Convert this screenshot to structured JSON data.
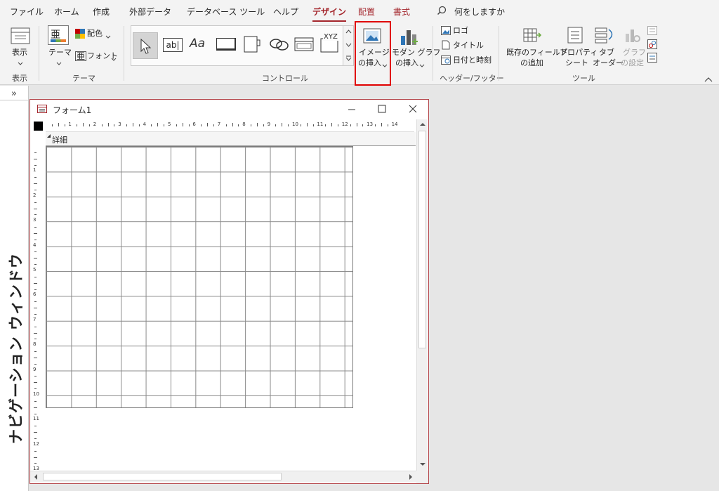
{
  "menu": {
    "file": "ファイル",
    "home": "ホーム",
    "create": "作成",
    "external_data": "外部データ",
    "database_tools": "データベース ツール",
    "help": "ヘルプ",
    "design": "デザイン",
    "arrange": "配置",
    "format": "書式",
    "tell_me": "何をしますか"
  },
  "ribbon": {
    "view": {
      "label": "表示",
      "group": "表示"
    },
    "theme": {
      "theme_label": "テーマ",
      "colors_label": "配色",
      "fonts_label": "フォント",
      "group": "テーマ",
      "theme_glyph": "亜",
      "font_glyph": "亜"
    },
    "controls": {
      "group": "コントロール",
      "textbox_glyph": "ab|",
      "label_glyph": "Aa",
      "xyz_glyph": "XYZ"
    },
    "insert_image": {
      "line1": "イメージ",
      "line2": "の挿入"
    },
    "modern_chart": {
      "line1": "モダン グラフ",
      "line2": "の挿入"
    },
    "header_footer": {
      "logo": "ロゴ",
      "title": "タイトル",
      "datetime": "日付と時刻",
      "group": "ヘッダー/フッター"
    },
    "tools": {
      "existing_fields": {
        "line1": "既存のフィールド",
        "line2": "の追加"
      },
      "property_sheet": {
        "line1": "プロパティ",
        "line2": "シート"
      },
      "tab_order": {
        "line1": "タブ",
        "line2": "オーダー"
      },
      "chart_settings": {
        "line1": "グラフ",
        "line2": "の設定"
      },
      "group": "ツール"
    }
  },
  "nav_pane": {
    "title": "ナビゲーション ウィンドウ",
    "expand": "»"
  },
  "form_window": {
    "title": "フォーム1",
    "section_label": "詳細",
    "ruler_h": [
      "1",
      "2",
      "3",
      "4",
      "5",
      "6",
      "7",
      "8",
      "9",
      "10",
      "11",
      "12",
      "13",
      "14"
    ],
    "ruler_v": [
      "1",
      "2",
      "3",
      "4",
      "5",
      "6",
      "7",
      "8",
      "9",
      "10",
      "11",
      "12",
      "13"
    ]
  },
  "colors": {
    "accent": "#a4262c",
    "highlight_box": "#e00000",
    "ribbon_bg": "#f3f3f3",
    "workspace": "#e6e6e6"
  }
}
